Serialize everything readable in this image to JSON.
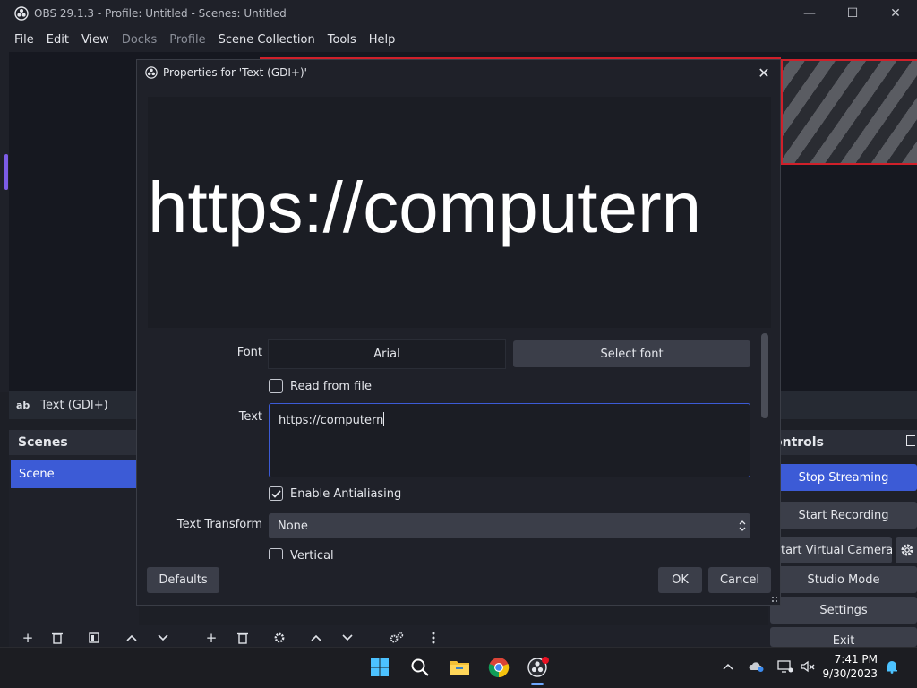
{
  "window": {
    "title": "OBS 29.1.3 - Profile: Untitled - Scenes: Untitled",
    "minimize_glyph": "—",
    "maximize_glyph": "☐",
    "close_glyph": "✕"
  },
  "menu": {
    "items": [
      "File",
      "Edit",
      "View",
      "Docks",
      "Profile",
      "Scene Collection",
      "Tools",
      "Help"
    ]
  },
  "source_bar": {
    "icon_text": "ab",
    "label": "Text (GDI+)"
  },
  "scenes_dock": {
    "title": "Scenes",
    "items": [
      "Scene"
    ]
  },
  "controls_dock": {
    "title": "ontrols",
    "buttons": [
      "Stop Streaming",
      "Start Recording",
      "tart Virtual Camera",
      "Studio Mode",
      "Settings",
      "Exit"
    ]
  },
  "dialog": {
    "title": "Properties for 'Text (GDI+)'",
    "close_glyph": "✕",
    "preview_text": "https://computern",
    "font_label": "Font",
    "font_value": "Arial",
    "select_font_button": "Select font",
    "read_from_file_label": "Read from file",
    "read_from_file_checked": false,
    "text_label": "Text",
    "text_value": "https://computern",
    "antialiasing_label": "Enable Antialiasing",
    "antialiasing_checked": true,
    "text_transform_label": "Text Transform",
    "text_transform_value": "None",
    "vertical_label": "Vertical",
    "defaults_button": "Defaults",
    "ok_button": "OK",
    "cancel_button": "Cancel"
  },
  "taskbar": {
    "apps": [
      "start-button",
      "search",
      "file-explorer",
      "chrome",
      "obs-studio"
    ],
    "time": "7:41 PM",
    "date": "9/30/2023"
  },
  "colors": {
    "accent": "#3c5bd6",
    "recording_red": "#d0202a",
    "dialog_bg": "#1f2129"
  }
}
